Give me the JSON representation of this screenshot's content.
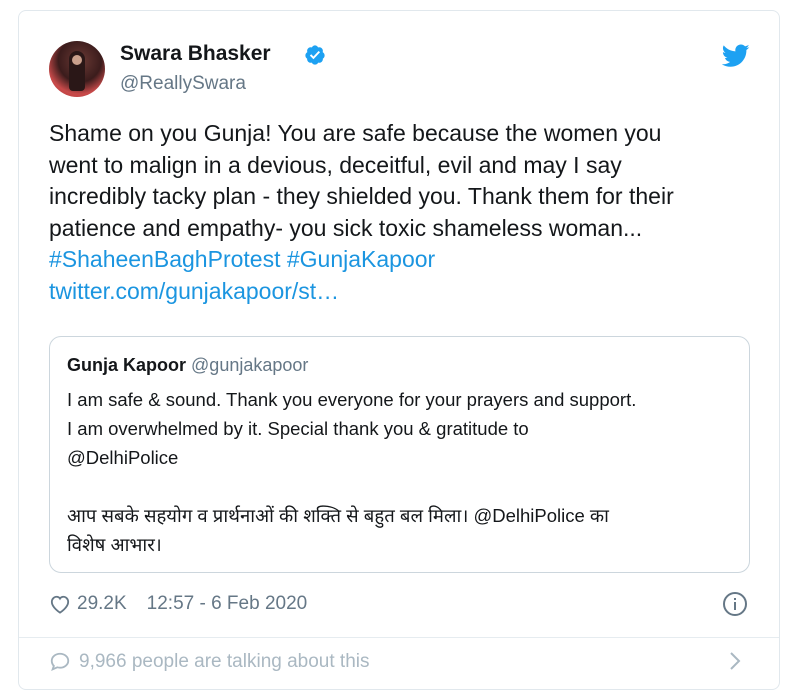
{
  "tweet": {
    "author_name": "Swara Bhasker",
    "author_handle": "@ReallySwara",
    "verified_icon": "verified-badge-icon",
    "platform_icon": "twitter-bird-icon",
    "text_lines": [
      "Shame on you Gunja! You are safe because the women you",
      "went to malign in a devious, deceitful, evil and may I say",
      "incredibly tacky plan - they shielded you. Thank them for their",
      "patience and empathy- you sick toxic shameless woman..."
    ],
    "hashtags": "#ShaheenBaghProtest #GunjaKapoor",
    "link": "twitter.com/gunjakapoor/st…"
  },
  "quoted": {
    "author_name": "Gunja Kapoor",
    "author_handle": "@gunjakapoor",
    "text_lines": [
      "I am safe & sound. Thank you everyone for your prayers and support.",
      "I am overwhelmed by it. Special thank you & gratitude to",
      "@DelhiPolice"
    ],
    "hindi_lines": [
      "आप सबके सहयोग व प्रार्थनाओं की शक्ति से बहुत बल मिला। @DelhiPolice का",
      "विशेष आभार।"
    ]
  },
  "meta": {
    "likes": "29.2K",
    "timestamp": "12:57 - 6 Feb 2020"
  },
  "footer": {
    "talking": "9,966 people are talking about this"
  },
  "colors": {
    "link": "#1b95e0",
    "secondary_text": "#657786",
    "border": "#e1e8ed"
  }
}
